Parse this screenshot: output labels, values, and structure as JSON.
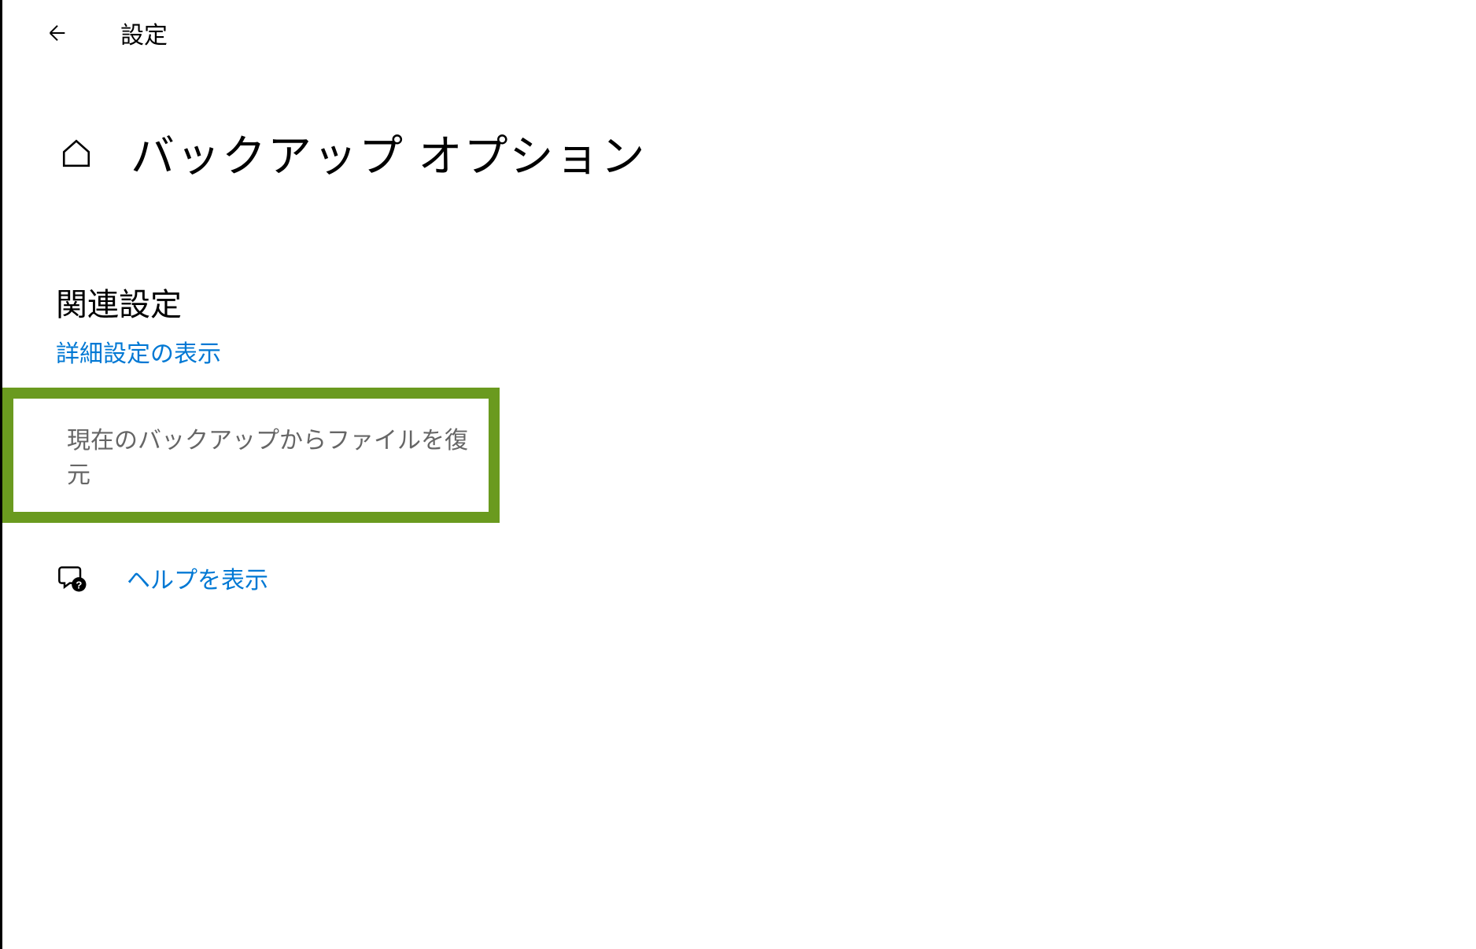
{
  "header": {
    "title": "設定"
  },
  "page": {
    "title": "バックアップ オプション"
  },
  "section": {
    "heading": "関連設定",
    "link_advanced": "詳細設定の表示",
    "link_restore": "現在のバックアップからファイルを復元"
  },
  "help": {
    "label": "ヘルプを表示"
  }
}
